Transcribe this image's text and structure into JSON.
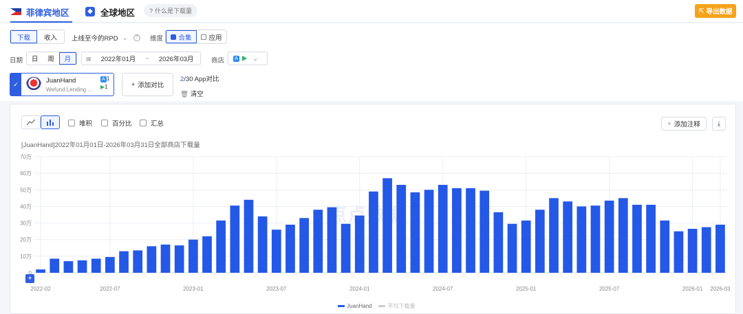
{
  "topbar": {
    "tabs": [
      {
        "label": "菲律宾地区",
        "active": true
      },
      {
        "label": "全球地区",
        "active": false
      }
    ],
    "help_label": "什么是下载量",
    "export_label": "导出数据"
  },
  "controls": {
    "metric_tabs": [
      "下载",
      "收入"
    ],
    "metric_active": "下载",
    "range_select": "上线至今的RPD",
    "dimension_label": "维度",
    "dimension_tabs": [
      "合集",
      "应用"
    ],
    "dimension_active": "合集",
    "date_label": "日期",
    "granularity_tabs": [
      "日",
      "周",
      "月"
    ],
    "granularity_active": "月",
    "date_start": "2022年01月",
    "date_sep": "~",
    "date_end": "2026年03月",
    "store_label": "商店"
  },
  "app": {
    "name": "JuanHand",
    "publisher": "Wefund Lending ...",
    "ios_count": "1",
    "android_count": "1"
  },
  "compare": {
    "add_label": "添加对比",
    "count_current": "2",
    "count_suffix": "/30 App对比",
    "clear_label": "清空"
  },
  "chart_toolbar": {
    "options": [
      "堆积",
      "百分比",
      "汇总"
    ],
    "add_note_label": "添加注释"
  },
  "watermark": "点点数据",
  "colors": {
    "accent": "#2f5fe0",
    "bar": "#2458e6",
    "export": "#f7a21b"
  },
  "chart_data": {
    "type": "bar",
    "title": "[JuanHand]2022年01月01日-2026年03月31日全部商店下载量",
    "y_ticks": [
      "0",
      "10万",
      "20万",
      "30万",
      "40万",
      "50万",
      "60万",
      "70万"
    ],
    "ylim": [
      0,
      700000
    ],
    "x_tick_labels": [
      {
        "index": 0,
        "label": "2022-02"
      },
      {
        "index": 5,
        "label": "2022-07"
      },
      {
        "index": 11,
        "label": "2023-01"
      },
      {
        "index": 17,
        "label": "2023-07"
      },
      {
        "index": 23,
        "label": "2024-01"
      },
      {
        "index": 29,
        "label": "2024-07"
      },
      {
        "index": 35,
        "label": "2025-01"
      },
      {
        "index": 41,
        "label": "2025-07"
      },
      {
        "index": 47,
        "label": "2026-01"
      },
      {
        "index": 49,
        "label": "2026-03"
      }
    ],
    "categories": [
      "2022-02",
      "2022-03",
      "2022-04",
      "2022-05",
      "2022-06",
      "2022-07",
      "2022-08",
      "2022-09",
      "2022-10",
      "2022-11",
      "2022-12",
      "2023-01",
      "2023-02",
      "2023-03",
      "2023-04",
      "2023-05",
      "2023-06",
      "2023-07",
      "2023-08",
      "2023-09",
      "2023-10",
      "2023-11",
      "2023-12",
      "2024-01",
      "2024-02",
      "2024-03",
      "2024-04",
      "2024-05",
      "2024-06",
      "2024-07",
      "2024-08",
      "2024-09",
      "2024-10",
      "2024-11",
      "2024-12",
      "2025-01",
      "2025-02",
      "2025-03",
      "2025-04",
      "2025-05",
      "2025-06",
      "2025-07",
      "2025-08",
      "2025-09",
      "2025-10",
      "2025-11",
      "2025-12",
      "2026-01",
      "2026-02",
      "2026-03"
    ],
    "series": [
      {
        "name": "JuanHand",
        "color": "#2458e6",
        "values": [
          20000,
          85000,
          70000,
          75000,
          85000,
          95000,
          130000,
          135000,
          160000,
          170000,
          165000,
          200000,
          220000,
          315000,
          405000,
          440000,
          340000,
          260000,
          290000,
          330000,
          380000,
          395000,
          295000,
          345000,
          490000,
          570000,
          530000,
          485000,
          500000,
          530000,
          510000,
          510000,
          495000,
          365000,
          295000,
          315000,
          380000,
          450000,
          430000,
          400000,
          405000,
          435000,
          450000,
          410000,
          410000,
          315000,
          250000,
          265000,
          275000,
          290000
        ]
      }
    ],
    "legend": [
      "JuanHand",
      "平均下载量"
    ],
    "legend_position": "bottom",
    "grid": true
  }
}
